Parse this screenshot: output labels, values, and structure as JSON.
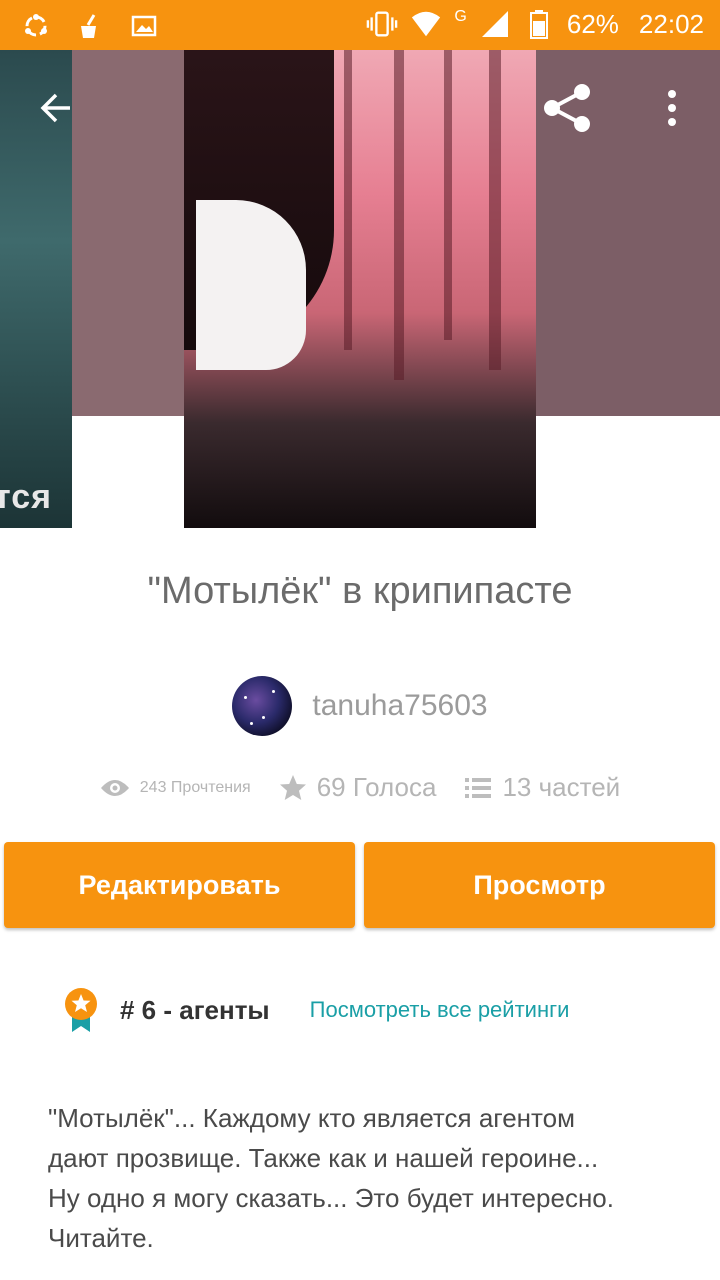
{
  "status_bar": {
    "battery": "62%",
    "time": "22:02",
    "network": "G"
  },
  "story": {
    "title": "\"Мотылёк\" в крипипасте",
    "author": "tanuha75603",
    "side_cover_text": "тся",
    "stats": {
      "reads": "243 Прочтения",
      "votes": "69 Голоса",
      "parts": "13 частей"
    },
    "ranking": {
      "text": "# 6 - агенты",
      "link": "Посмотреть все рейтинги"
    },
    "description": "\"Мотылёк\"... Каждому кто является агентом\nдают прозвище. Также как и нашей героине...\nНу одно я могу сказать... Это будет интересно.\nЧитайте."
  },
  "actions": {
    "edit_label": "Редактировать",
    "view_label": "Просмотр"
  },
  "colors": {
    "accent": "#f7930f",
    "link": "#1a9fa6"
  }
}
